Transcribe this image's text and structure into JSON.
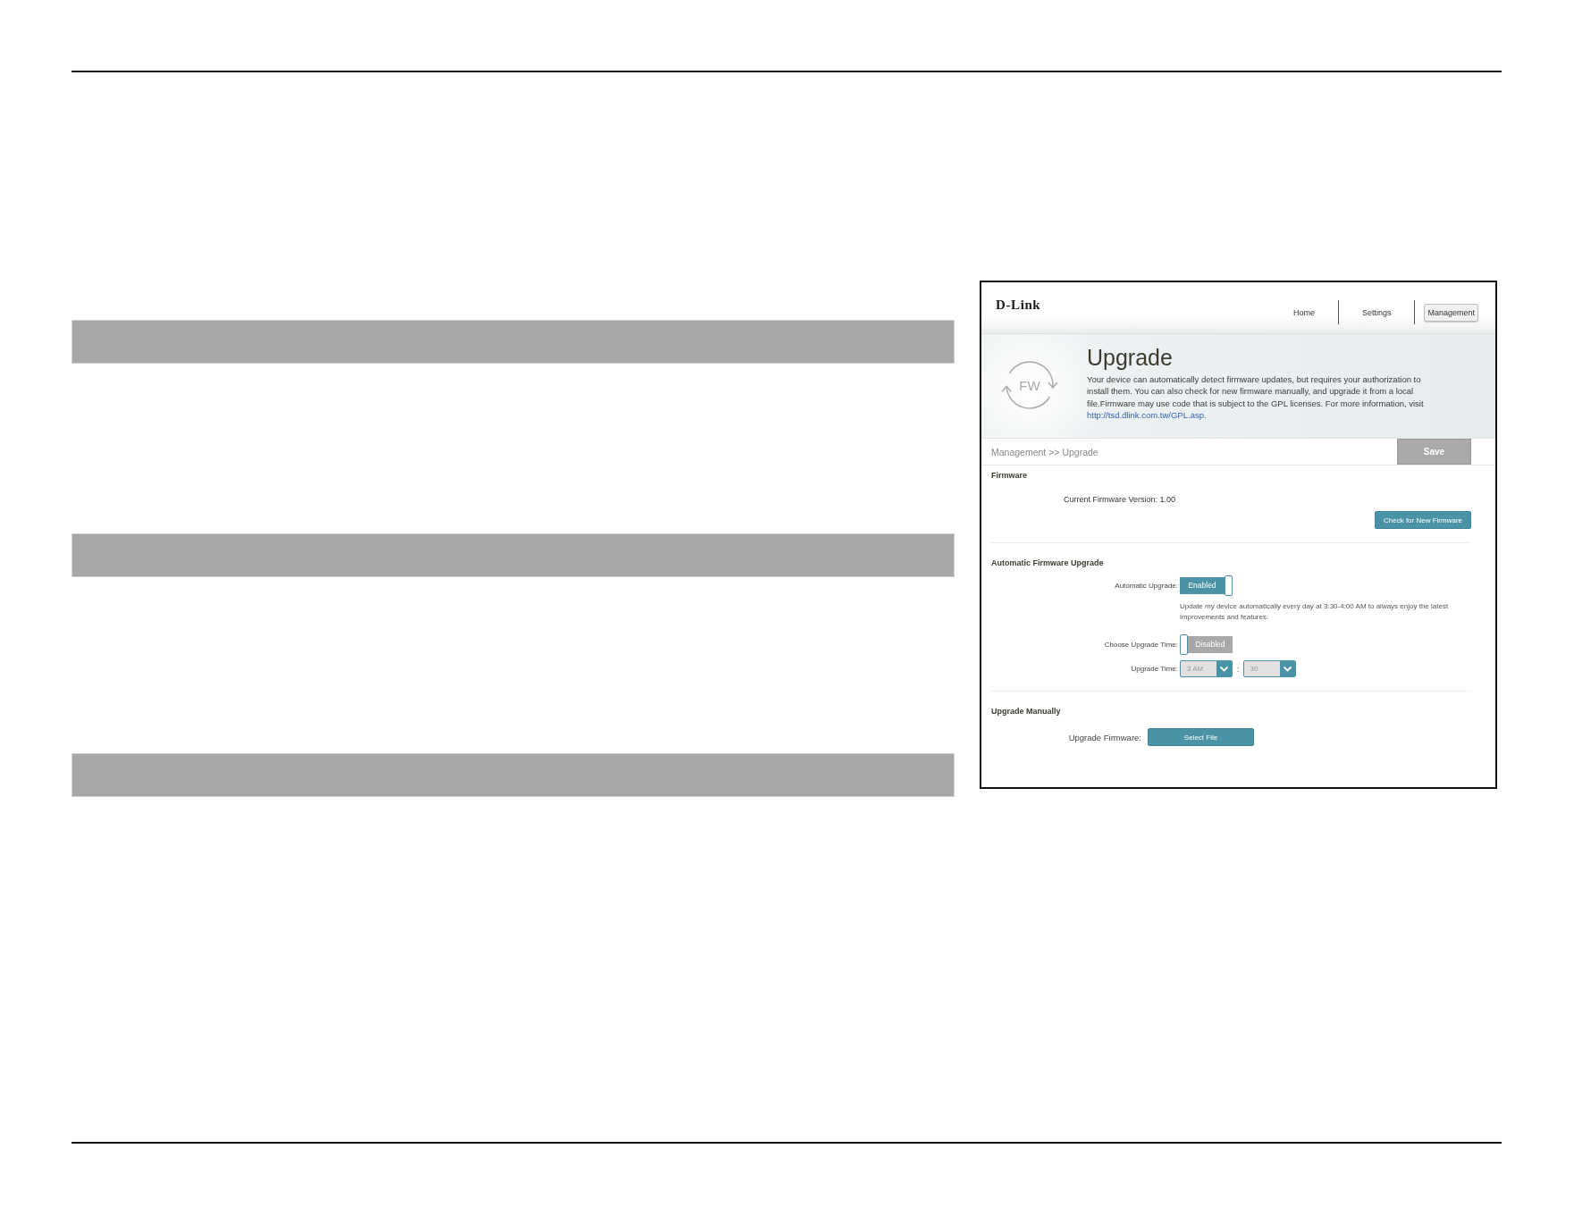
{
  "screenshot": {
    "brand": "D-Link",
    "nav": [
      {
        "label": "Home",
        "selected": false
      },
      {
        "label": "Settings",
        "selected": false
      },
      {
        "label": "Management",
        "selected": true
      }
    ],
    "banner": {
      "icon_label": "FW",
      "title": "Upgrade",
      "description": "Your device can automatically detect firmware updates, but requires your authorization to install them. You can also check for new firmware manually, and upgrade it from a local file.Firmware may use code that is subject to the GPL licenses. For more information, visit",
      "link": "http://tsd.dlink.com.tw/GPL.asp."
    },
    "breadcrumb": "Management >> Upgrade",
    "save_button": {
      "label": "Save",
      "disabled": true
    },
    "sections": [
      {
        "title": "Firmware",
        "rows": [
          {
            "kind": "info",
            "text": "Current Firmware Version: 1.00"
          },
          {
            "kind": "action",
            "label": "Check for New Firmware"
          }
        ]
      },
      {
        "title": "Automatic Firmware Upgrade",
        "rows": [
          {
            "kind": "toggle",
            "label": "Automatic Upgrade:",
            "value": "Enabled",
            "on": true
          },
          {
            "kind": "note",
            "text": "Update my device automatically every day at 3:30-4:00 AM to always enjoy the latest improvements and features."
          },
          {
            "kind": "toggle",
            "label": "Choose Upgrade Time:",
            "value": "Disabled",
            "on": false
          },
          {
            "kind": "time",
            "label": "Upgrade Time:",
            "hour": {
              "value": "3 AM",
              "disabled": true
            },
            "separator": ":",
            "minute": {
              "value": "30",
              "disabled": true
            }
          }
        ]
      },
      {
        "title": "Upgrade Manually",
        "rows": [
          {
            "kind": "file",
            "label": "Upgrade Firmware:",
            "button": "Select File"
          }
        ]
      }
    ]
  }
}
